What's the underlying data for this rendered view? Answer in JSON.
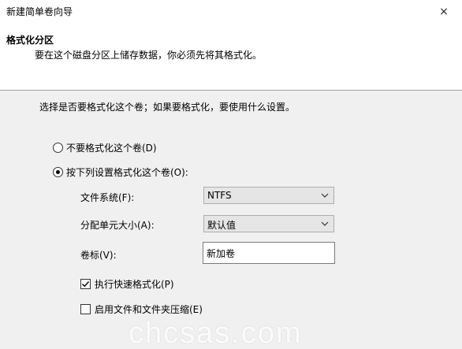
{
  "window": {
    "title": "新建简单卷向导",
    "close_icon": "×"
  },
  "header": {
    "heading": "格式化分区",
    "subheading": "要在这个磁盘分区上储存数据，你必须先将其格式化。"
  },
  "content": {
    "instruction": "选择是否要格式化这个卷；如果要格式化，要使用什么设置。",
    "radio_no_format": {
      "label": "不要格式化这个卷(D)",
      "checked": false
    },
    "radio_format": {
      "label": "按下列设置格式化这个卷(O):",
      "checked": true
    },
    "file_system": {
      "label": "文件系统(F):",
      "value": "NTFS"
    },
    "allocation_unit": {
      "label": "分配单元大小(A):",
      "value": "默认值"
    },
    "volume_label": {
      "label": "卷标(V):",
      "value": "新加卷"
    },
    "quick_format": {
      "label": "执行快速格式化(P)",
      "checked": true
    },
    "compression": {
      "label": "启用文件和文件夹压缩(E)",
      "checked": false
    }
  },
  "watermark": "chcsas.com"
}
